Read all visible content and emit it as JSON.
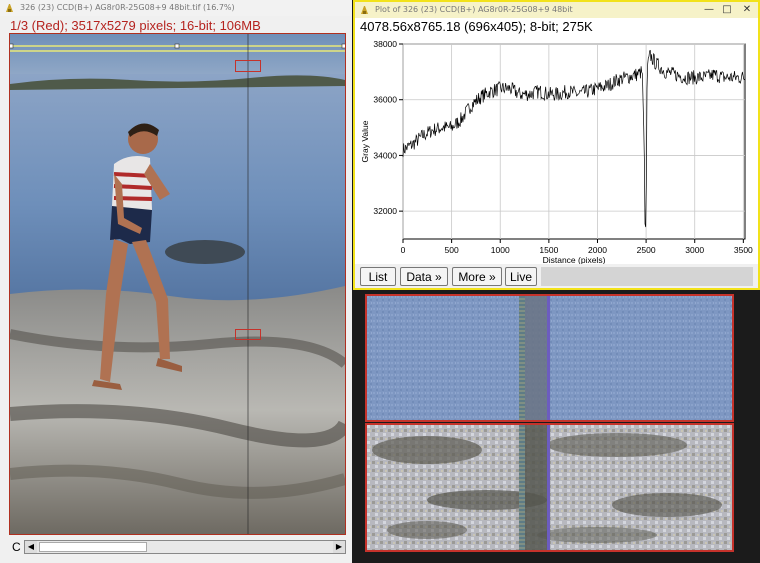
{
  "image_window": {
    "title": "326 (23) CCD(B+) AG8r0R-25G08+9 48bit.tif (16.7%)",
    "info": "1/3 (Red); 3517x5279 pixels; 16-bit; 106MB",
    "channel_indicator": "C"
  },
  "plot_window": {
    "title": "Plot of 326 (23) CCD(B+) AG8r0R-25G08+9 48bit",
    "info": "4078.56x8765.18    (696x405); 8-bit; 275K",
    "buttons": [
      "List",
      "Data »",
      "More »",
      "Live"
    ]
  },
  "colors": {
    "selection": "#c5322b",
    "plot_border": "#f2e21a",
    "info_text": "#b5231f"
  },
  "chart_data": {
    "type": "line",
    "xlabel": "Distance (pixels)",
    "ylabel": "Gray Value",
    "xlim": [
      0,
      3517
    ],
    "ylim": [
      31000,
      38000
    ],
    "xticks": [
      0,
      500,
      1000,
      1500,
      2000,
      2500,
      3000,
      3500
    ],
    "yticks": [
      32000,
      34000,
      36000,
      38000
    ],
    "grid": true,
    "series": [
      {
        "x": [
          0,
          100,
          200,
          300,
          400,
          500,
          600,
          700,
          800,
          900,
          1000,
          1100,
          1200,
          1300,
          1400,
          1500,
          1600,
          1700,
          1800,
          1900,
          2000,
          2100,
          2200,
          2300,
          2400,
          2460,
          2480,
          2490,
          2500,
          2510,
          2520,
          2540,
          2600,
          2700,
          2800,
          2900,
          3000,
          3100,
          3200,
          3300,
          3400,
          3517
        ],
        "y": [
          34200,
          34400,
          34700,
          34900,
          35000,
          35000,
          35300,
          35800,
          36100,
          36300,
          36400,
          36400,
          36200,
          36200,
          36300,
          36200,
          36200,
          36300,
          36200,
          36300,
          36400,
          36500,
          36700,
          36800,
          36900,
          37000,
          34500,
          31200,
          31600,
          36800,
          37300,
          37600,
          37300,
          37000,
          36900,
          36800,
          36800,
          36800,
          36900,
          36800,
          36800,
          36800
        ]
      }
    ]
  }
}
